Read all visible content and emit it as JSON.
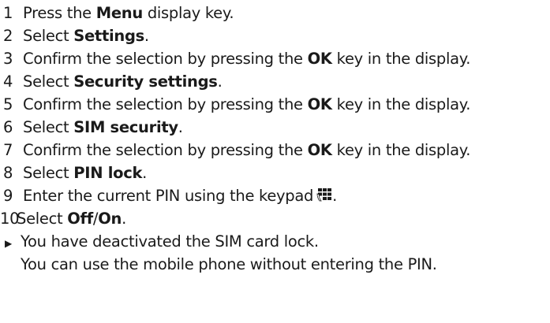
{
  "steps": [
    {
      "n": "1",
      "pre": "Press the ",
      "bold": "Menu",
      "post": " display key."
    },
    {
      "n": "2",
      "pre": "Select ",
      "bold": "Settings",
      "post": "."
    },
    {
      "n": "3",
      "pre": "Confirm the selection by pressing the ",
      "bold": "OK",
      "post": " key in the display."
    },
    {
      "n": "4",
      "pre": "Select ",
      "bold": "Security settings",
      "post": "."
    },
    {
      "n": "5",
      "pre": "Confirm the selection by pressing the ",
      "bold": "OK",
      "post": " key in the display."
    },
    {
      "n": "6",
      "pre": "Select ",
      "bold": "SIM security",
      "post": "."
    },
    {
      "n": "7",
      "pre": "Confirm the selection by pressing the ",
      "bold": "OK",
      "post": " key in the display."
    },
    {
      "n": "8",
      "pre": "Select ",
      "bold": "PIN lock",
      "post": "."
    },
    {
      "n": "9",
      "pre": "Enter the current PIN using the keypad",
      "post": "."
    },
    {
      "n": "10",
      "pre": "Select ",
      "bold": "Off",
      "mid": "/",
      "bold2": "On",
      "post": "."
    }
  ],
  "result": {
    "line1": "You have deactivated the SIM card lock.",
    "line2": "You can use the mobile phone without entering the PIN."
  },
  "icons": {
    "keypad": "keypad-icon",
    "result_marker": "triangle-right-icon"
  }
}
